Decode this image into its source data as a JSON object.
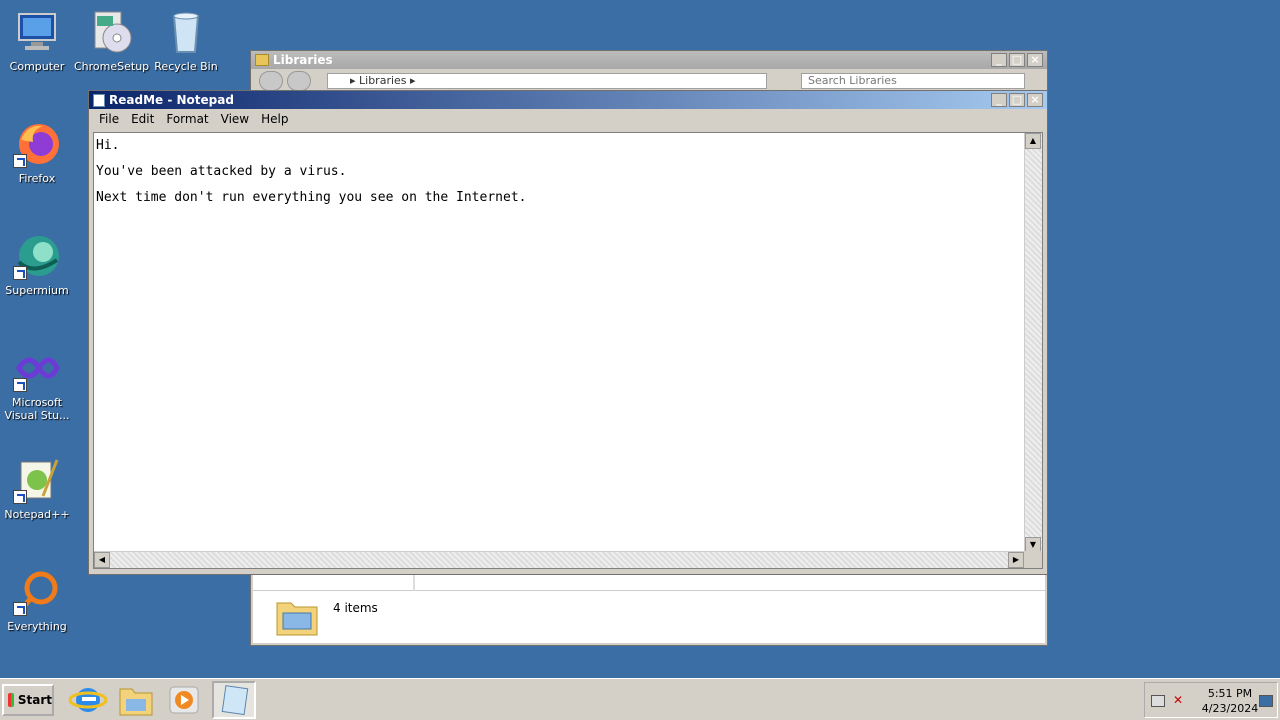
{
  "desktop": {
    "icons": [
      {
        "label": "Computer"
      },
      {
        "label": "ChromeSetup"
      },
      {
        "label": "Recycle Bin"
      },
      {
        "label": "Firefox"
      },
      {
        "label": "Supermium"
      },
      {
        "label": "Microsoft Visual Stu..."
      },
      {
        "label": "Notepad++"
      },
      {
        "label": "Everything"
      }
    ]
  },
  "libraries": {
    "title": "Libraries",
    "address": "▸ Libraries ▸",
    "search_placeholder": "Search Libraries",
    "status_count": "4 items"
  },
  "notepad": {
    "title": "ReadMe - Notepad",
    "menu": [
      "File",
      "Edit",
      "Format",
      "View",
      "Help"
    ],
    "lines": [
      "Hi.",
      "You've been attacked by a virus.",
      "Next time don't run everything you see on the Internet."
    ]
  },
  "taskbar": {
    "start_label": "Start",
    "time": "5:51 PM",
    "date": "4/23/2024"
  },
  "colors": {
    "desktop_bg": "#3b6ea5",
    "notepad_title_gradient_start": "#0a246a",
    "notepad_title_gradient_end": "#a6caf0"
  }
}
